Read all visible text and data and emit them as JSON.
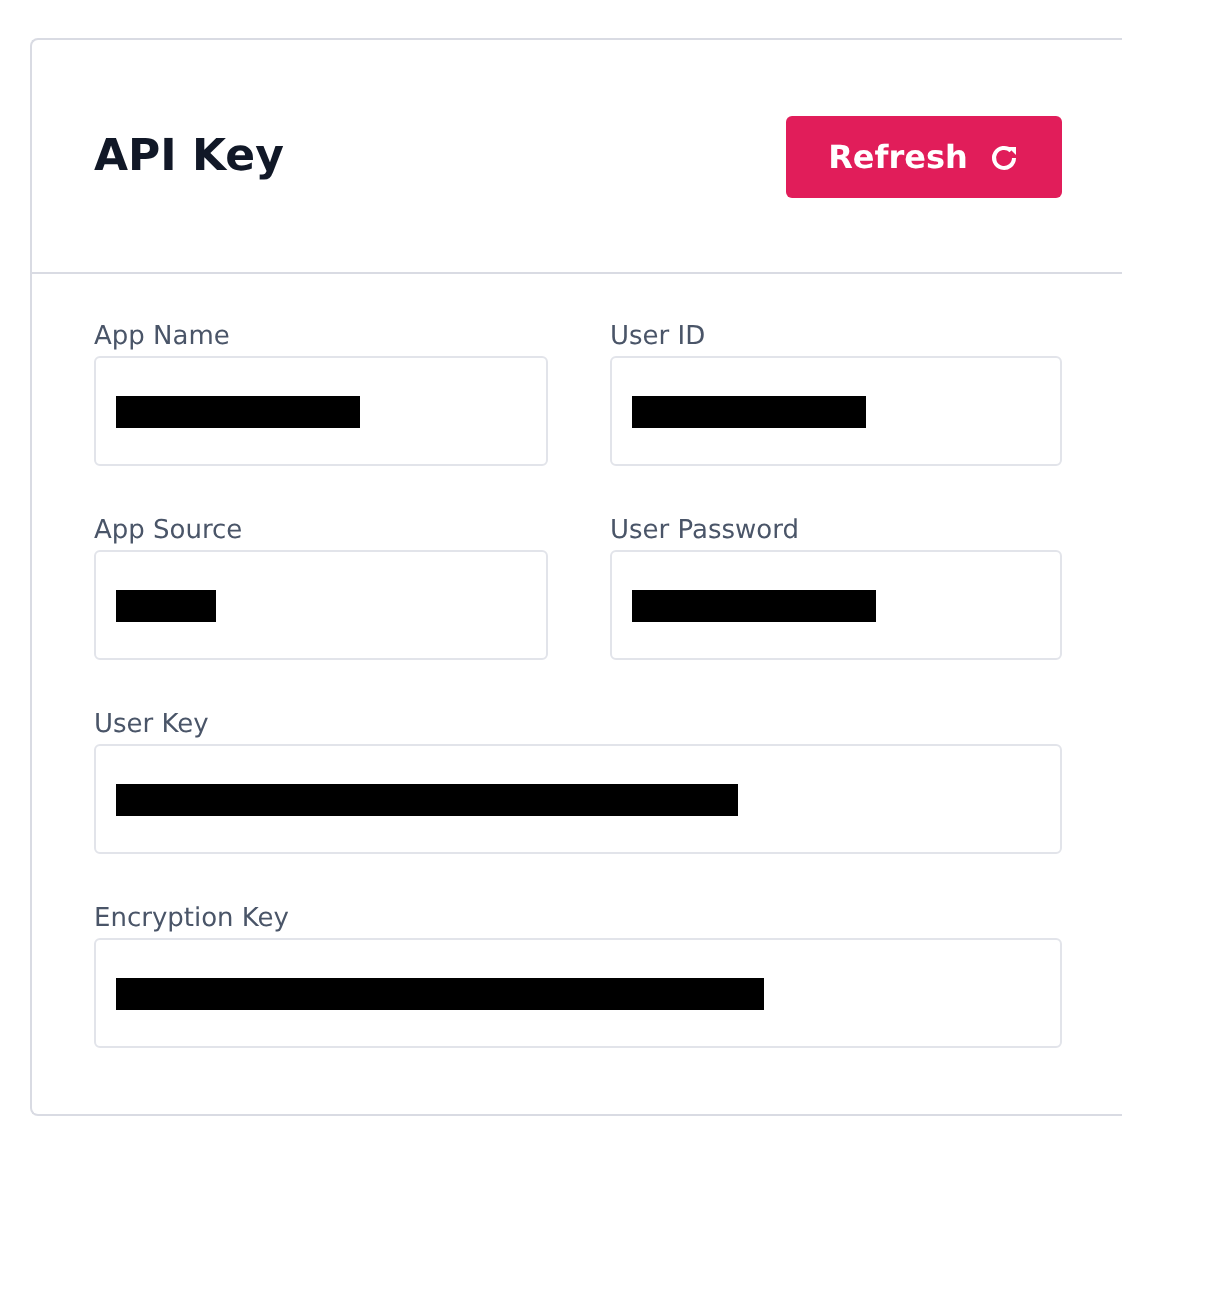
{
  "card": {
    "title": "API Key",
    "refresh_button": {
      "label": "Refresh"
    }
  },
  "fields": [
    {
      "label": "App Name",
      "kind": "half",
      "redacted": true
    },
    {
      "label": "User ID",
      "kind": "half",
      "redacted": true
    },
    {
      "label": "App Source",
      "kind": "half",
      "redacted": true
    },
    {
      "label": "User Password",
      "kind": "half",
      "redacted": true
    },
    {
      "label": "User Key",
      "kind": "full",
      "redacted": true
    },
    {
      "label": "Encryption Key",
      "kind": "full",
      "redacted": true
    }
  ]
}
